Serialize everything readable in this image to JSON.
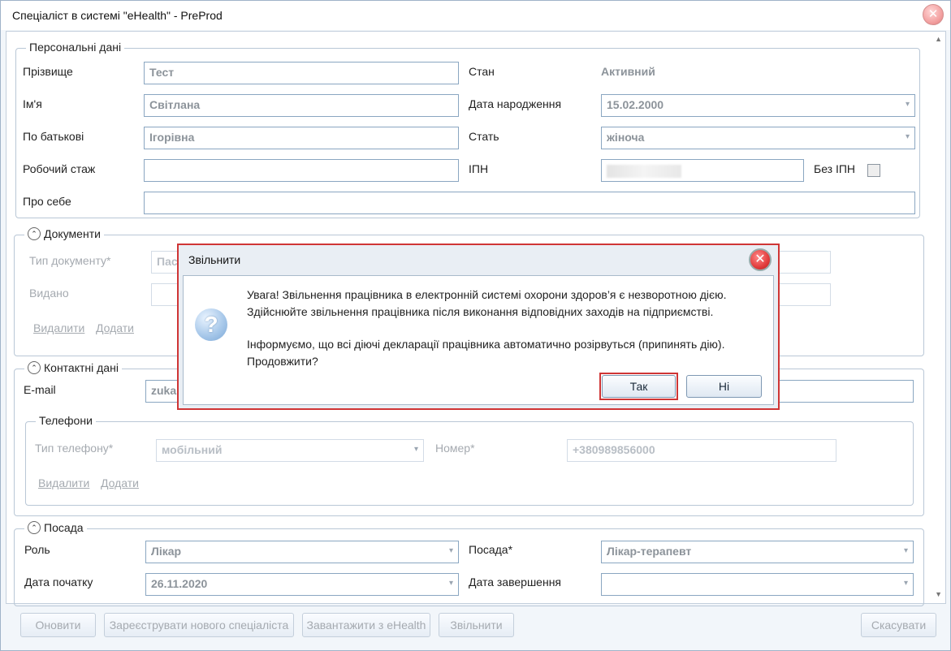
{
  "window": {
    "title": "Спеціаліст в системі \"eHealth\" - PreProd",
    "close_glyph": "✕"
  },
  "personal": {
    "legend": "Персональні дані",
    "surname_label": "Прізвище",
    "surname_value": "Тест",
    "name_label": "Ім'я",
    "name_value": "Світлана",
    "patronymic_label": "По батькові",
    "patronymic_value": "Ігорівна",
    "experience_label": "Робочий стаж",
    "experience_value": "",
    "about_label": "Про себе",
    "about_value": "",
    "status_label": "Стан",
    "status_value": "Активний",
    "birth_label": "Дата народження",
    "birth_value": "15.02.2000",
    "gender_label": "Стать",
    "gender_value": "жіноча",
    "ipn_label": "ІПН",
    "no_ipn_label": "Без ІПН"
  },
  "documents": {
    "legend": "Документи",
    "type_label": "Тип документу*",
    "type_value": "Пас",
    "issued_label": "Видано",
    "delete_link": "Видалити",
    "add_link": "Додати"
  },
  "contacts": {
    "legend": "Контактні дані",
    "email_label": "E-mail",
    "email_value": "zuka",
    "phones_legend": "Телефони",
    "phone_type_label": "Тип телефону*",
    "phone_type_value": "мобільний",
    "number_label": "Номер*",
    "number_value": "+380989856000",
    "delete_link": "Видалити",
    "add_link": "Додати"
  },
  "position": {
    "legend": "Посада",
    "role_label": "Роль",
    "role_value": "Лікар",
    "start_label": "Дата початку",
    "start_value": "26.11.2020",
    "post_label": "Посада*",
    "post_value": "Лікар-терапевт",
    "end_label": "Дата завершення",
    "end_value": ""
  },
  "footer": {
    "refresh": "Оновити",
    "register": "Зареєструвати нового спеціаліста",
    "load": "Завантажити з eHealth",
    "dismiss": "Звільнити",
    "cancel": "Скасувати"
  },
  "modal": {
    "title": "Звільнити",
    "close_glyph": "✕",
    "icon_glyph": "?",
    "line1": "Увага! Звільнення працівника в електронній системі охорони здоров’я є незворотною дією.",
    "line2": "Здійснюйте звільнення працівника після виконання відповідних заходів на підприємстві.",
    "line3": "Інформуємо, що всі діючі декларації працівника автоматично розірвуться (припинять дію).",
    "line4": "Продовжити?",
    "yes": "Так",
    "no": "Ні"
  }
}
